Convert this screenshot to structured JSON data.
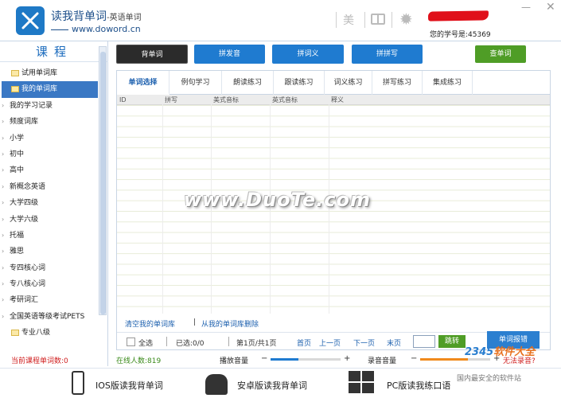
{
  "header": {
    "app_title": "读我背单词",
    "app_subtitle": "-英语单词",
    "website": "www.doword.cn",
    "mei_button": "美",
    "user_id_label": "您的学号是:45369",
    "minimize": "—",
    "close": "✕"
  },
  "sidebar": {
    "title": "课程",
    "items": [
      {
        "label": "试用单词库",
        "kind": "folder"
      },
      {
        "label": "我的单词库",
        "kind": "folder",
        "selected": true
      },
      {
        "label": "我的学习记录",
        "kind": "node"
      },
      {
        "label": "频度词库",
        "kind": "node"
      },
      {
        "label": "小学",
        "kind": "node"
      },
      {
        "label": "初中",
        "kind": "node"
      },
      {
        "label": "高中",
        "kind": "node"
      },
      {
        "label": "新概念英语",
        "kind": "node"
      },
      {
        "label": "大学四级",
        "kind": "node"
      },
      {
        "label": "大学六级",
        "kind": "node"
      },
      {
        "label": "托福",
        "kind": "node"
      },
      {
        "label": "雅思",
        "kind": "node"
      },
      {
        "label": "专四核心词",
        "kind": "node"
      },
      {
        "label": "专八核心词",
        "kind": "node"
      },
      {
        "label": "考研词汇",
        "kind": "node"
      },
      {
        "label": "全国英语等级考试PETS",
        "kind": "node"
      },
      {
        "label": "专业八级",
        "kind": "folder"
      }
    ],
    "word_count_label": "当前课程单词数:0"
  },
  "toolbar": {
    "bei": "背单词",
    "fa": "拼发音",
    "ci": "拼词义",
    "pin": "拼拼写",
    "cha": "查单词"
  },
  "tabs": [
    "单词选择",
    "例句学习",
    "朗读练习",
    "跟读练习",
    "词义练习",
    "拼写练习",
    "集成练习"
  ],
  "table": {
    "columns": [
      "ID",
      "拼写",
      "美式音标",
      "英式音标",
      "释义"
    ]
  },
  "watermark": "www.DuoTe.com",
  "links": {
    "clear": "清空我的单词库",
    "sep": "|",
    "delete": "从我的单词库删除"
  },
  "pager": {
    "select_all": "全选",
    "selected": "已选:0/0",
    "page_info": "第1页/共1页",
    "first": "首页",
    "prev": "上一页",
    "next": "下一页",
    "last": "末页",
    "jump": "跳转"
  },
  "report_button": "单词报错",
  "status": {
    "online": "在线人数:819",
    "play_volume": "播放音量",
    "record_volume": "录音音量",
    "minus": "−",
    "plus": "+",
    "record_warning": "无法录音?",
    "play_level": 0.4,
    "record_level": 0.68
  },
  "footer": {
    "ios": "IOS版读我背单词",
    "android": "安卓版读我背单词",
    "pc": "PC版读我练口语"
  },
  "badge": {
    "logo_num": "2345",
    "logo_text": "软件大全",
    "sub": "国内最安全的软件站"
  },
  "colors": {
    "accent": "#1f7bd0",
    "green": "#4f9d26",
    "selected": "#3a78c4"
  }
}
